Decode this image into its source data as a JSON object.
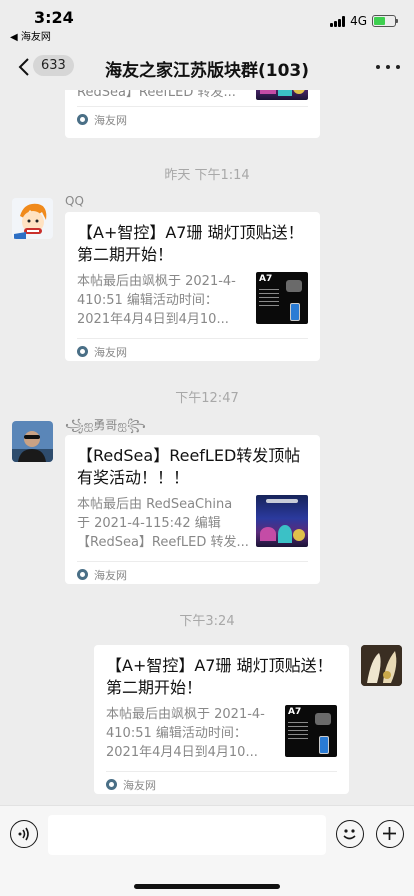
{
  "status": {
    "time": "3:24",
    "back_app": "◀ 海友网",
    "network": "4G"
  },
  "nav": {
    "back_count": "633",
    "title": "海友之家江苏版块群(103)"
  },
  "colors": {
    "background": "#ededed",
    "card": "#ffffff",
    "battery": "#3ecf4f",
    "source_icon": "#4a6f86"
  },
  "messages": [
    {
      "type": "card",
      "partial": true,
      "desc_tail": "RedSea】ReefLED 转发...",
      "source": "海友网"
    },
    {
      "type": "time",
      "text": "昨天 下午1:14"
    },
    {
      "type": "card",
      "sender": "QQ",
      "title": "【A+智控】A7珊 瑚灯顶贴送！第二期开始！",
      "desc": "本帖最后由飒枫于 2021-4-410:51 编辑活动时间：2021年4月4日到4月10...",
      "thumb": "a7",
      "thumb_label": "A7",
      "source": "海友网"
    },
    {
      "type": "time",
      "text": "下午12:47"
    },
    {
      "type": "card",
      "sender": "꧁ஐ勇哥ஐ꧂",
      "title": "【RedSea】ReefLED转发顶帖有奖活动！！！",
      "desc": "本帖最后由 RedSeaChina 于 2021-4-115:42 编辑【RedSea】ReefLED 转发...",
      "thumb": "reef",
      "source": "海友网"
    },
    {
      "type": "time",
      "text": "下午3:24"
    },
    {
      "type": "card",
      "self": true,
      "title": "【A+智控】A7珊 瑚灯顶贴送！第二期开始！",
      "desc": "本帖最后由飒枫于 2021-4-410:51 编辑活动时间：2021年4月4日到4月10...",
      "thumb": "a7",
      "thumb_label": "A7",
      "source": "海友网"
    }
  ],
  "input": {
    "placeholder": ""
  }
}
